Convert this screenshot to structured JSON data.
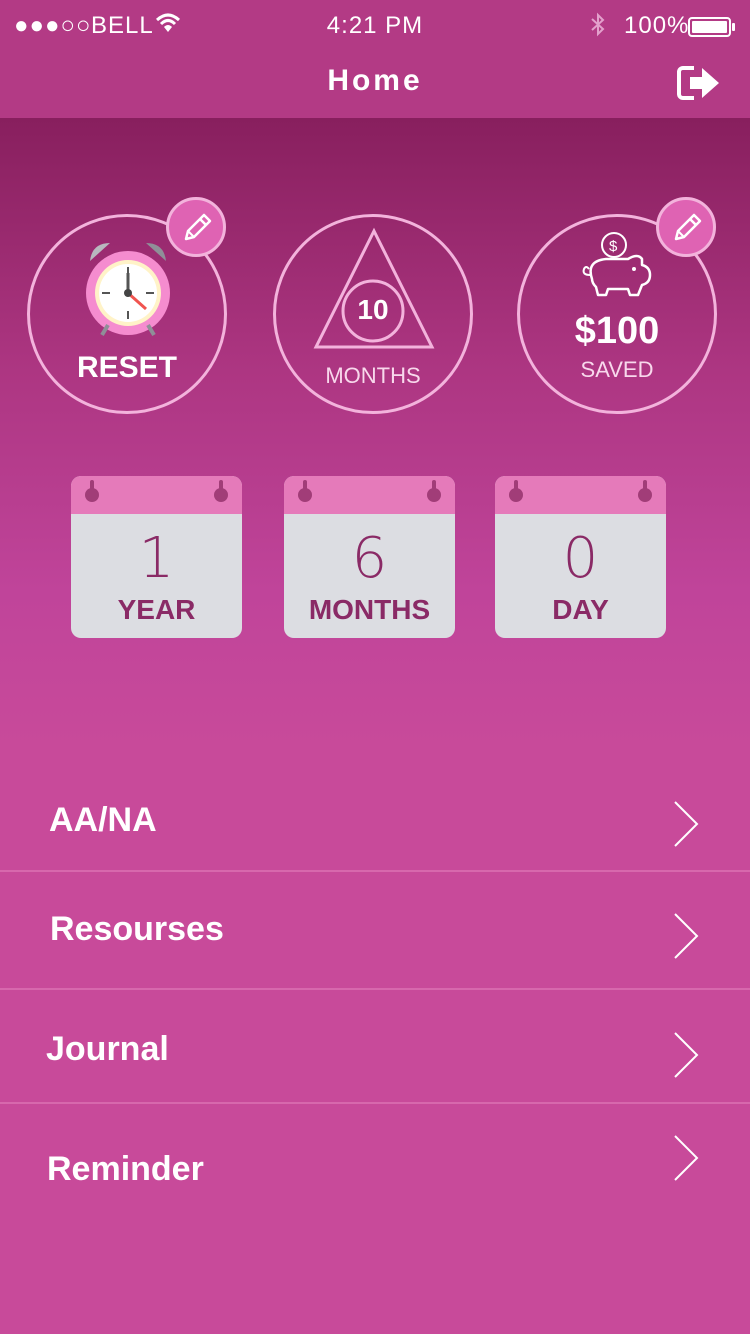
{
  "status_bar": {
    "signal": "●●●○○",
    "carrier": "BELL",
    "time": "4:21 PM",
    "battery_percent": "100%"
  },
  "nav": {
    "title": "Home",
    "logout_icon": "logout-icon"
  },
  "stats": {
    "reset": {
      "label": "RESET",
      "icon": "alarm-clock-icon"
    },
    "months": {
      "value": "10",
      "label": "MONTHS",
      "icon": "triangle-icon"
    },
    "saved": {
      "amount": "$100",
      "label": "SAVED",
      "icon": "piggy-bank-icon"
    }
  },
  "duration": [
    {
      "value": "1",
      "unit": "YEAR"
    },
    {
      "value": "6",
      "unit": "MONTHS"
    },
    {
      "value": "0",
      "unit": "DAY"
    }
  ],
  "menu": [
    {
      "label": "AA/NA"
    },
    {
      "label": "Resourses"
    },
    {
      "label": "Journal"
    },
    {
      "label": "Reminder"
    }
  ],
  "colors": {
    "accent": "#c84a9a",
    "header": "#b33a85",
    "hero_top": "#881f5e",
    "card_head": "#e57aba",
    "card_text": "#8a2a66"
  }
}
